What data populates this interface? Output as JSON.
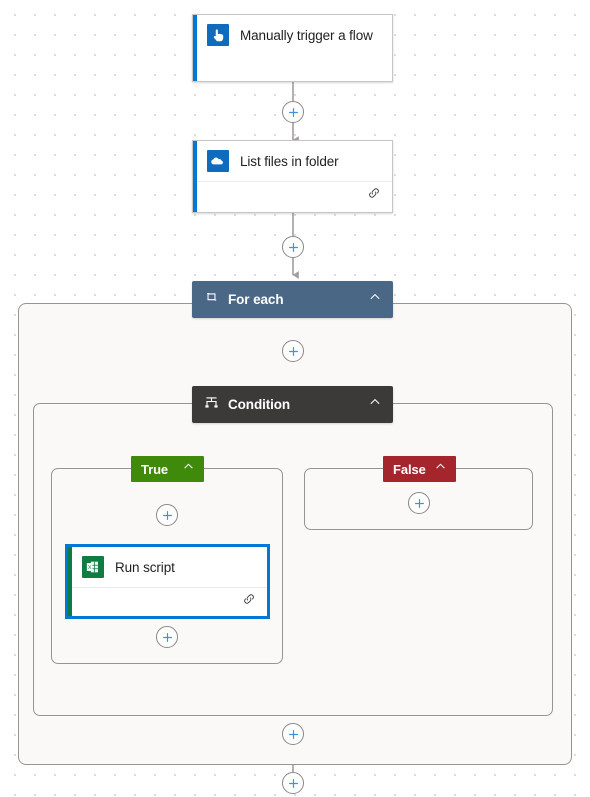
{
  "app": {
    "name": "Power Automate flow designer canvas",
    "background": "#ffffff",
    "grid_dot_color": "#dcdcdc"
  },
  "colors": {
    "accent_blue": "#0078d4",
    "trigger_icon": "#0f6cbd",
    "onedrive_icon": "#0f6cbd",
    "excel_icon": "#107c41",
    "foreach_header": "#4a6785",
    "condition_header": "#3b3a39",
    "true_badge": "#3f8a0b",
    "false_badge": "#a4262c",
    "connector": "#a19f9d",
    "scope_fill": "#faf9f8",
    "scope_border": "#979593",
    "selection": "#0078d4"
  },
  "flow": {
    "trigger": {
      "title": "Manually trigger a flow",
      "icon": "manual-trigger-icon",
      "accent": "#0078d4",
      "has_footer": false,
      "selected": false
    },
    "actions": [
      {
        "id": "list-files-in-folder",
        "title": "List files in folder",
        "icon": "onedrive-icon",
        "accent": "#0078d4",
        "has_footer": true,
        "footer_icon": "link-icon",
        "selected": false
      },
      {
        "id": "run-script",
        "title": "Run script",
        "icon": "excel-icon",
        "accent": "#107c41",
        "has_footer": true,
        "footer_icon": "link-icon",
        "selected": true
      }
    ],
    "scopes": [
      {
        "id": "for-each",
        "title": "For each",
        "icon": "loop-icon",
        "header_color": "#4a6785",
        "expanded": true,
        "collapse_icon": "chevron-up-icon"
      },
      {
        "id": "condition",
        "title": "Condition",
        "icon": "condition-icon",
        "header_color": "#3b3a39",
        "expanded": true,
        "collapse_icon": "chevron-up-icon"
      }
    ],
    "branches": [
      {
        "id": "true-branch",
        "label": "True",
        "color": "#3f8a0b",
        "collapse_icon": "chevron-up-icon",
        "empty": false
      },
      {
        "id": "false-branch",
        "label": "False",
        "color": "#a4262c",
        "collapse_icon": "chevron-up-icon",
        "empty": true
      }
    ],
    "insert_buttons": [
      {
        "id": "insert-after-trigger",
        "tooltip": "Insert a new step"
      },
      {
        "id": "insert-after-list-files",
        "tooltip": "Insert a new step"
      },
      {
        "id": "insert-inside-for-each",
        "tooltip": "Insert a new step"
      },
      {
        "id": "insert-in-true-branch",
        "tooltip": "Insert a new step"
      },
      {
        "id": "insert-after-run-script",
        "tooltip": "Insert a new step"
      },
      {
        "id": "insert-in-false-branch",
        "tooltip": "Insert a new step"
      },
      {
        "id": "insert-after-condition",
        "tooltip": "Insert a new step"
      },
      {
        "id": "insert-after-for-each",
        "tooltip": "Insert a new step"
      }
    ]
  }
}
